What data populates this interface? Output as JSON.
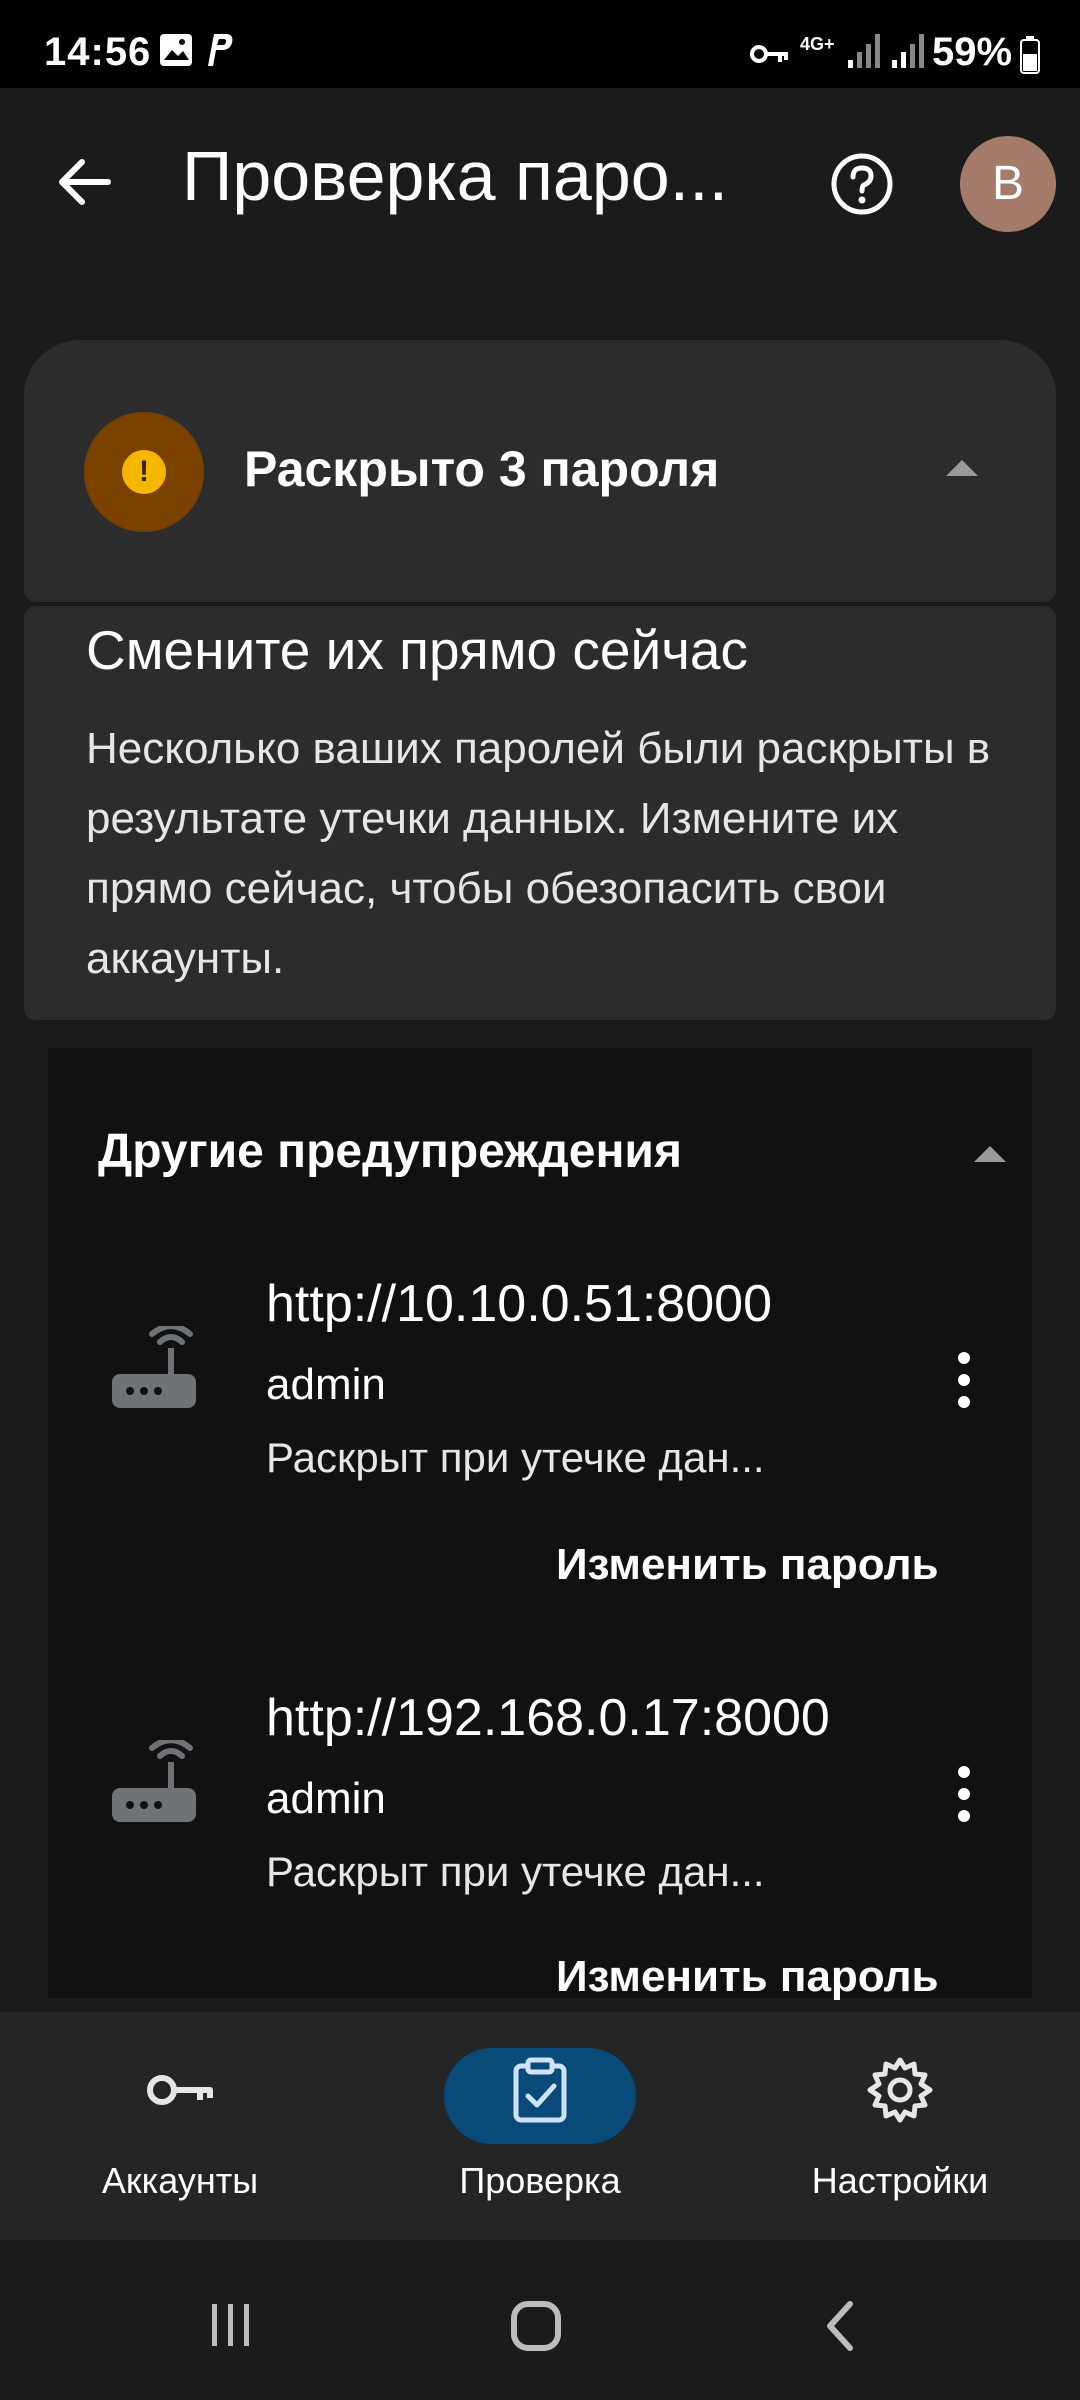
{
  "status_bar": {
    "time": "14:56",
    "network": "4G+",
    "battery": "59%"
  },
  "app_bar": {
    "title": "Проверка паро...",
    "avatar_letter": "B"
  },
  "compromised_card": {
    "title": "Раскрыто 3 пароля",
    "heading": "Смените их прямо сейчас",
    "description": "Несколько ваших паролей были раскрыты в результате утечки данных. Измените их прямо сейчас, чтобы обезопасить свои аккаунты.",
    "accent_color": "#f5b600"
  },
  "other_warnings": {
    "title": "Другие предупреждения",
    "items": [
      {
        "url": "http://10.10.0.51:8000",
        "username": "admin",
        "status": "Раскрыт при утечке дан...",
        "action": "Изменить пароль",
        "icon": "router-icon"
      },
      {
        "url": "http://192.168.0.17:8000",
        "username": "admin",
        "status": "Раскрыт при утечке дан...",
        "action": "Изменить пароль",
        "icon": "router-icon"
      }
    ]
  },
  "bottom_nav": {
    "items": [
      {
        "label": "Аккаунты",
        "icon": "key-icon"
      },
      {
        "label": "Проверка",
        "icon": "clipboard-check-icon",
        "selected": true
      },
      {
        "label": "Настройки",
        "icon": "gear-icon"
      }
    ],
    "selected_color": "#0a4a78"
  }
}
